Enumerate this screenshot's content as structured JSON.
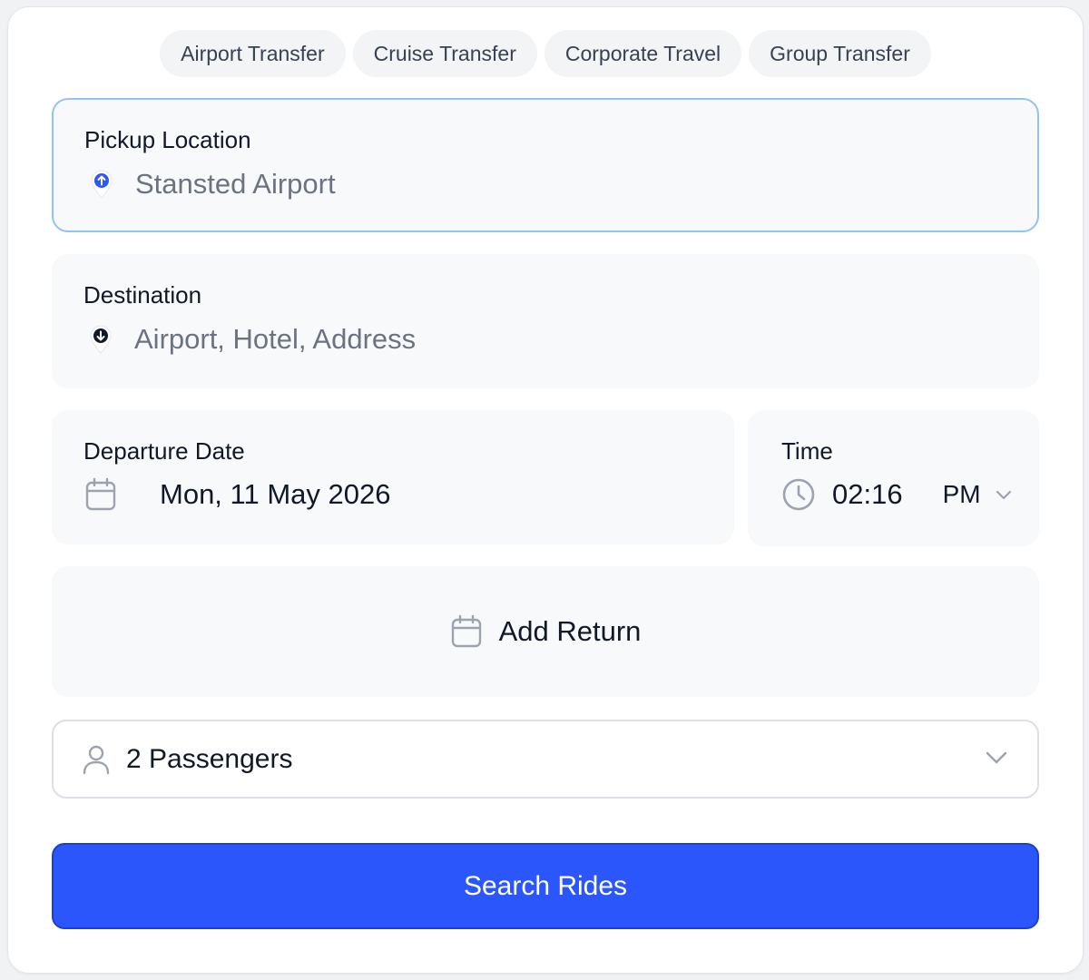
{
  "tabs": [
    "Airport Transfer",
    "Cruise Transfer",
    "Corporate Travel",
    "Group Transfer"
  ],
  "pickup": {
    "label": "Pickup Location",
    "value": "Stansted Airport",
    "icon": "pickup-pin-icon"
  },
  "destination": {
    "label": "Destination",
    "placeholder": "Airport, Hotel, Address",
    "icon": "destination-pin-icon"
  },
  "departure": {
    "label": "Departure Date",
    "value": "Mon, 11 May 2026",
    "icon": "calendar-icon"
  },
  "time": {
    "label": "Time",
    "value": "02:16",
    "period": "PM",
    "icon": "clock-icon"
  },
  "return": {
    "label": "Add Return",
    "icon": "calendar-icon"
  },
  "passengers": {
    "value": "2 Passengers",
    "icon": "user-icon"
  },
  "search": {
    "label": "Search Rides"
  },
  "colors": {
    "accent": "#2a56fb",
    "active_border": "#93c2f6",
    "panel": "#f8f9fb"
  }
}
